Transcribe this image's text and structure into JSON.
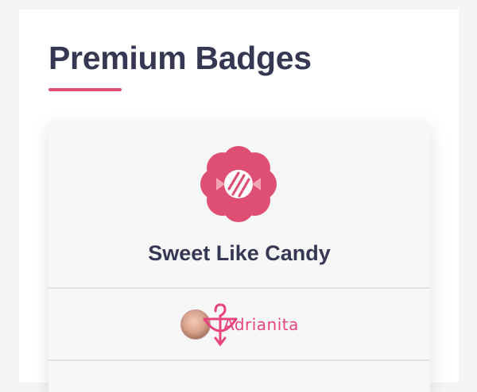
{
  "page": {
    "title": "Premium Badges"
  },
  "badge": {
    "name": "Sweet Like Candy",
    "icon": "candy-flower-icon"
  },
  "owner": {
    "name": "Adrianita",
    "avatar": "avatar",
    "decoration": "cupid-bow-icon"
  },
  "colors": {
    "accent": "#df4f74",
    "title": "#363853",
    "owner_name": "#e8457d"
  }
}
